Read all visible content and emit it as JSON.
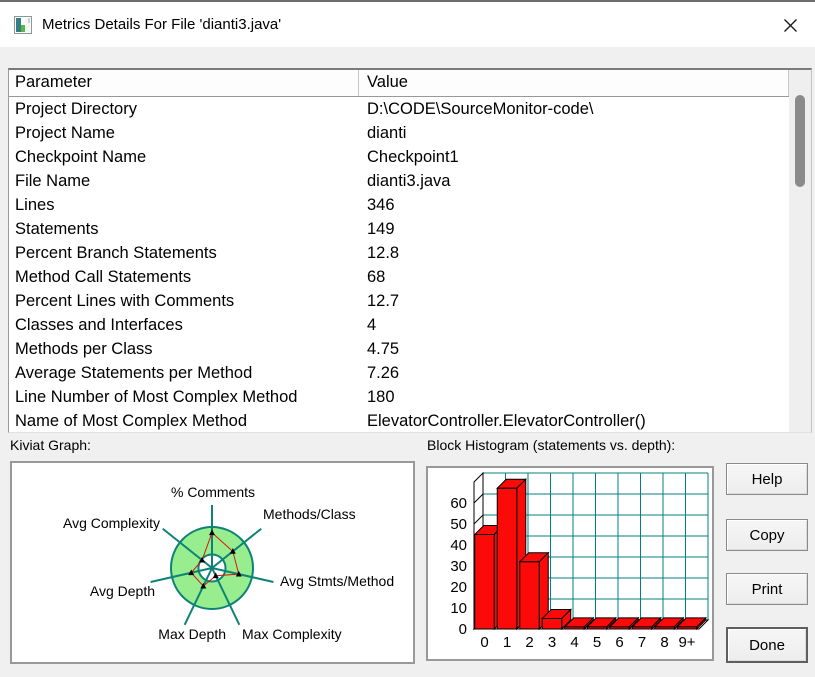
{
  "window": {
    "title": "Metrics Details For File 'dianti3.java'"
  },
  "table": {
    "columns": [
      "Parameter",
      "Value"
    ],
    "rows": [
      [
        "Project Directory",
        "D:\\CODE\\SourceMonitor-code\\"
      ],
      [
        "Project Name",
        "dianti"
      ],
      [
        "Checkpoint Name",
        "Checkpoint1"
      ],
      [
        "File Name",
        "dianti3.java"
      ],
      [
        "Lines",
        "346"
      ],
      [
        "Statements",
        "149"
      ],
      [
        "Percent Branch Statements",
        "12.8"
      ],
      [
        "Method Call Statements",
        "68"
      ],
      [
        "Percent Lines with Comments",
        "12.7"
      ],
      [
        "Classes and Interfaces",
        "4"
      ],
      [
        "Methods per Class",
        "4.75"
      ],
      [
        "Average Statements per Method",
        "7.26"
      ],
      [
        "Line Number of Most Complex Method",
        "180"
      ],
      [
        "Name of Most Complex Method",
        "ElevatorController.ElevatorController()"
      ]
    ]
  },
  "kiviat": {
    "label": "Kiviat Graph:"
  },
  "histogram": {
    "label": "Block Histogram (statements vs. depth):"
  },
  "buttons": {
    "help": "Help",
    "copy": "Copy",
    "print": "Print",
    "done": "Done"
  },
  "chart_data": [
    {
      "type": "radar",
      "title": "Kiviat Graph",
      "axes": [
        "% Comments",
        "Methods/Class",
        "Avg Stmts/Method",
        "Max Complexity",
        "Max Depth",
        "Avg Depth",
        "Avg Complexity"
      ],
      "values_fraction_of_outer": [
        0.86,
        0.65,
        0.67,
        0.21,
        0.49,
        0.52,
        0.31
      ],
      "acceptable_band_fraction": [
        0.33,
        1.0
      ],
      "legend_position": "none",
      "style": {
        "band_fill": "#98ee8e",
        "axis_color": "#0d8276",
        "series_color": "#e01212",
        "marker_color": "#000000"
      }
    },
    {
      "type": "bar",
      "title": "Block Histogram (statements vs. depth)",
      "categories": [
        "0",
        "1",
        "2",
        "3",
        "4",
        "5",
        "6",
        "7",
        "8",
        "9+"
      ],
      "values": [
        45,
        67,
        32,
        5,
        1,
        1,
        1,
        1,
        1,
        1
      ],
      "ylim": [
        0,
        70
      ],
      "ytick_step": 10,
      "ytick_labels_shown": [
        "0",
        "10",
        "20",
        "30",
        "40",
        "50",
        "60"
      ],
      "grid": true,
      "style": {
        "bar_fill": "#fb0a0a",
        "bar_outline": "#000000",
        "grid_color": "#008080",
        "wall_color": "#000000"
      }
    }
  ]
}
